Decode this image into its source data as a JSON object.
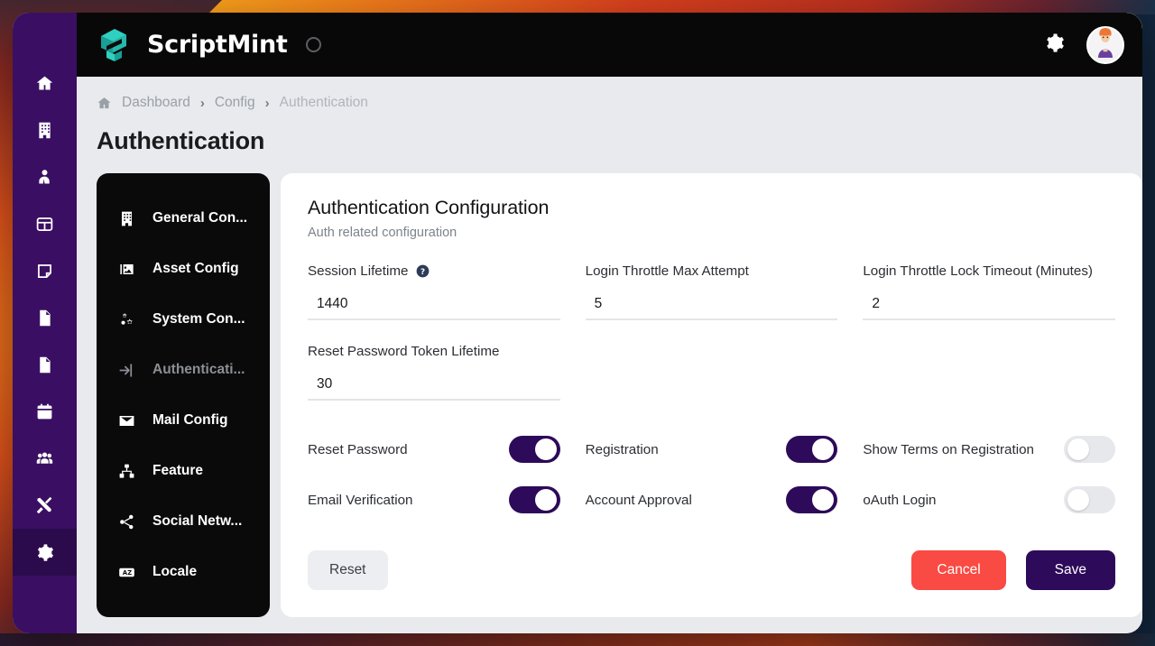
{
  "brand": {
    "name": "ScriptMint",
    "logo_icon": "scriptmint-logo-icon",
    "status_ring_icon": "status-ring-icon"
  },
  "topbar": {
    "settings_icon": "gear-icon",
    "avatar_icon": "user-avatar-icon"
  },
  "rail": {
    "items": [
      {
        "name": "home",
        "icon": "home-icon",
        "active": false
      },
      {
        "name": "organization",
        "icon": "building-icon",
        "active": false
      },
      {
        "name": "employees",
        "icon": "user-tie-icon",
        "active": false
      },
      {
        "name": "board",
        "icon": "table-icon",
        "active": false
      },
      {
        "name": "notes",
        "icon": "sticky-note-icon",
        "active": false
      },
      {
        "name": "invoices",
        "icon": "file-signature-icon",
        "active": false
      },
      {
        "name": "documents",
        "icon": "file-invoice-icon",
        "active": false
      },
      {
        "name": "calendar",
        "icon": "calendar-icon",
        "active": false
      },
      {
        "name": "teams",
        "icon": "users-icon",
        "active": false
      },
      {
        "name": "tools",
        "icon": "tools-icon",
        "active": false
      },
      {
        "name": "settings",
        "icon": "gear-icon",
        "active": true
      }
    ]
  },
  "breadcrumb": {
    "home_icon": "home-icon",
    "separator": "›",
    "items": [
      {
        "label": "Dashboard"
      },
      {
        "label": "Config"
      },
      {
        "label": "Authentication"
      }
    ]
  },
  "page": {
    "title": "Authentication"
  },
  "submenu": {
    "items": [
      {
        "label": "General Con...",
        "icon": "building-icon",
        "active": false
      },
      {
        "label": "Asset Config",
        "icon": "image-icon",
        "active": false
      },
      {
        "label": "System Con...",
        "icon": "cogs-icon",
        "active": false
      },
      {
        "label": "Authenticati...",
        "icon": "sign-in-icon",
        "active": true
      },
      {
        "label": "Mail Config",
        "icon": "envelope-icon",
        "active": false
      },
      {
        "label": "Feature",
        "icon": "sitemap-icon",
        "active": false
      },
      {
        "label": "Social Netw...",
        "icon": "share-nodes-icon",
        "active": false
      },
      {
        "label": "Locale",
        "icon": "language-icon",
        "active": false
      }
    ]
  },
  "form": {
    "heading": "Authentication Configuration",
    "subheading": "Auth related configuration",
    "fields": [
      {
        "label": "Session Lifetime",
        "value": "1440",
        "placeholder": "Session Lifetime",
        "has_help": true,
        "help_icon": "question-circle-icon"
      },
      {
        "label": "Login Throttle Max Attempt",
        "value": "5",
        "placeholder": "Login Throttle Max Attempt",
        "has_help": false
      },
      {
        "label": "Login Throttle Lock Timeout (Minutes)",
        "value": "2",
        "placeholder": "Login Throttle Lock Timeout (Minutes)",
        "has_help": false
      },
      {
        "label": "Reset Password Token Lifetime",
        "value": "30",
        "placeholder": "Reset Password Token Lifetime",
        "has_help": false
      }
    ],
    "toggles": [
      {
        "label": "Reset Password",
        "on": true
      },
      {
        "label": "Registration",
        "on": true
      },
      {
        "label": "Show Terms on Registration",
        "on": false
      },
      {
        "label": "Email Verification",
        "on": true
      },
      {
        "label": "Account Approval",
        "on": true
      },
      {
        "label": "oAuth Login",
        "on": false
      }
    ],
    "buttons": {
      "reset": "Reset",
      "cancel": "Cancel",
      "save": "Save"
    }
  },
  "colors": {
    "rail_purple": "#3a0f63",
    "rail_active": "#2b0b4c",
    "topbar_black": "#080808",
    "accent_purple": "#2e0a5a",
    "danger_red": "#f94a43",
    "logo_teal": "#22b3a6",
    "toggle_off": "#e6e8eb"
  }
}
